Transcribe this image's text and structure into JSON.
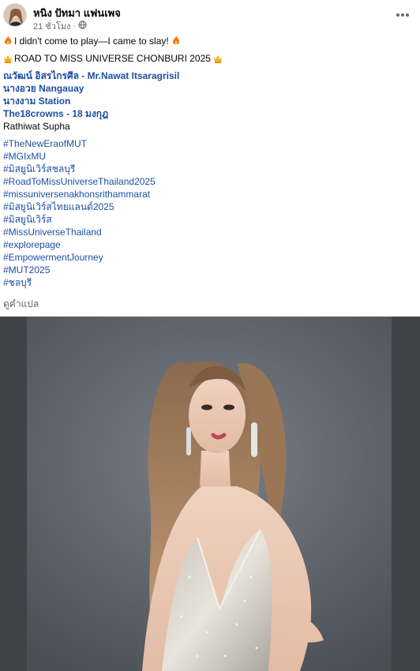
{
  "post": {
    "author": "หนิง ปัทมา แฟนเพจ",
    "time": "21 ชั่วโมง",
    "dot": "·",
    "line1": "I didn't come to play—I came to slay!",
    "line2": "ROAD TO MISS UNIVERSE CHONBURI  2025",
    "credits": [
      {
        "text": "ณวัฒน์ อิสรไกรศีล - Mr.Nawat Itsaragrisil",
        "style": "link"
      },
      {
        "text": "นางอวย Nangauay",
        "style": "link"
      },
      {
        "text": "นางงาม Station",
        "style": "link"
      },
      {
        "text": "The18crowns - 18 มงกุฎ",
        "style": "link"
      },
      {
        "text": "Rathiwat Supha",
        "style": "plain"
      }
    ],
    "hashtags": [
      "#TheNewEraofMUT",
      "#MGIxMU",
      "#มิสยูนิเวิร์สชลบุรี",
      "#RoadToMissUniverseThailand2025",
      "#missuniversenakhonsrithammarat",
      "#มิสยูนิเวิร์สไทยแลนด์2025",
      "#มิสยูนิเวิร์ส",
      "#MissUniverseThailand",
      "#explorepage",
      "#EmpowermentJourney",
      "#MUT2025",
      "#ชลบุรี"
    ],
    "see_translation": "ดูคำแปล"
  },
  "icons": {
    "fire": "fire-icon",
    "crown": "crown-icon",
    "globe": "globe-icon",
    "more": "more-options-icon"
  },
  "colors": {
    "link": "#1d4fa3",
    "muted": "#65676b",
    "photo_bg": "#5b5f66"
  }
}
